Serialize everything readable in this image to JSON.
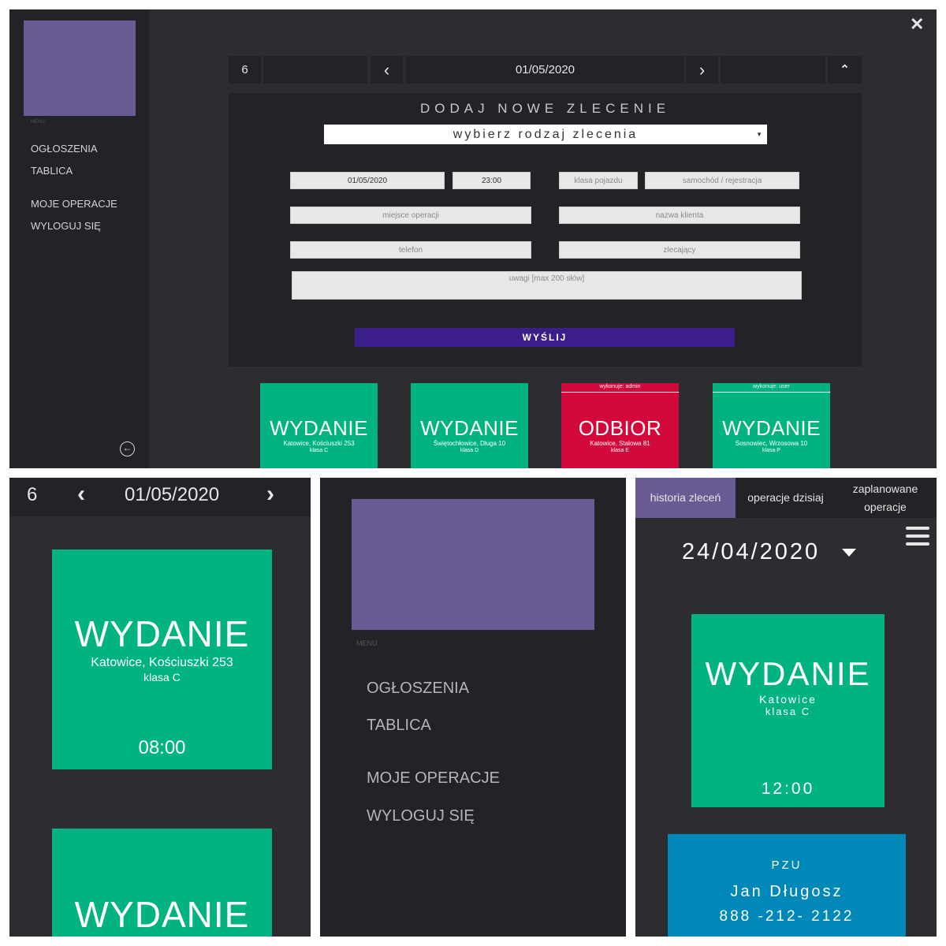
{
  "desktop": {
    "sidebar": {
      "menu_caption": "MENU",
      "items": [
        "OGŁOSZENIA",
        "TABLICA",
        "MOJE OPERACJE",
        "WYLOGUJ SIĘ"
      ]
    },
    "datebar": {
      "week": "6",
      "prev": "‹",
      "date": "01/05/2020",
      "next": "›",
      "collapse": "⌃"
    },
    "form": {
      "title": "DODAJ NOWE ZLECENIE",
      "type_select": "wybierz rodzaj zlecenia",
      "date_value": "01/05/2020",
      "time_value": "23:00",
      "vehicle_class_placeholder": "klasa pojazdu",
      "car_plate_placeholder": "samochód / rejestracja",
      "location_placeholder": "miejsce operacji",
      "client_placeholder": "nazwa klienta",
      "phone_placeholder": "telefon",
      "orderer_placeholder": "zlecający",
      "notes_placeholder": "uwagi [max 200 słów]",
      "submit": "WYŚLIJ"
    },
    "cards": [
      {
        "executor": "",
        "type": "WYDANIE",
        "address": "Katowice, Kościuszki 253",
        "class": "klasa C",
        "color": "#00b380"
      },
      {
        "executor": "",
        "type": "WYDANIE",
        "address": "Świętochłowice, Długa 10",
        "class": "klasa D",
        "color": "#00b380"
      },
      {
        "executor": "wykonuje: admin",
        "type": "ODBIOR",
        "address": "Katowice, Stalowa 81",
        "class": "klasa E",
        "color": "#d4093b"
      },
      {
        "executor": "wykonuje: user",
        "type": "WYDANIE",
        "address": "Sosnowiec, Wrzosowa 10",
        "class": "klasa P",
        "color": "#00b380"
      }
    ]
  },
  "mobile_day": {
    "week": "6",
    "date": "01/05/2020",
    "cards": [
      {
        "type": "WYDANIE",
        "address": "Katowice, Kościuszki 253",
        "class": "klasa C",
        "time": "08:00"
      },
      {
        "type": "WYDANIE"
      }
    ]
  },
  "mobile_menu": {
    "menu_caption": "MENU",
    "items": [
      "OGŁOSZENIA",
      "TABLICA",
      "MOJE OPERACJE",
      "WYLOGUJ SIĘ"
    ]
  },
  "history": {
    "tabs": [
      "historia zleceń",
      "operacje dzisiaj",
      "zaplanowane operacje"
    ],
    "active_tab": "historia zleceń",
    "date": "24/04/2020",
    "card": {
      "type": "WYDANIE",
      "city": "Katowice",
      "class": "klasa C",
      "time": "12:00"
    },
    "card2": {
      "insurer": "PZU",
      "name": "Jan Długosz",
      "phone": "888 -212- 2122"
    }
  },
  "colors": {
    "accent": "#6b5b95",
    "green": "#00b380",
    "red": "#d4093b",
    "blue": "#0088b8",
    "submit": "#3b1e8a"
  }
}
